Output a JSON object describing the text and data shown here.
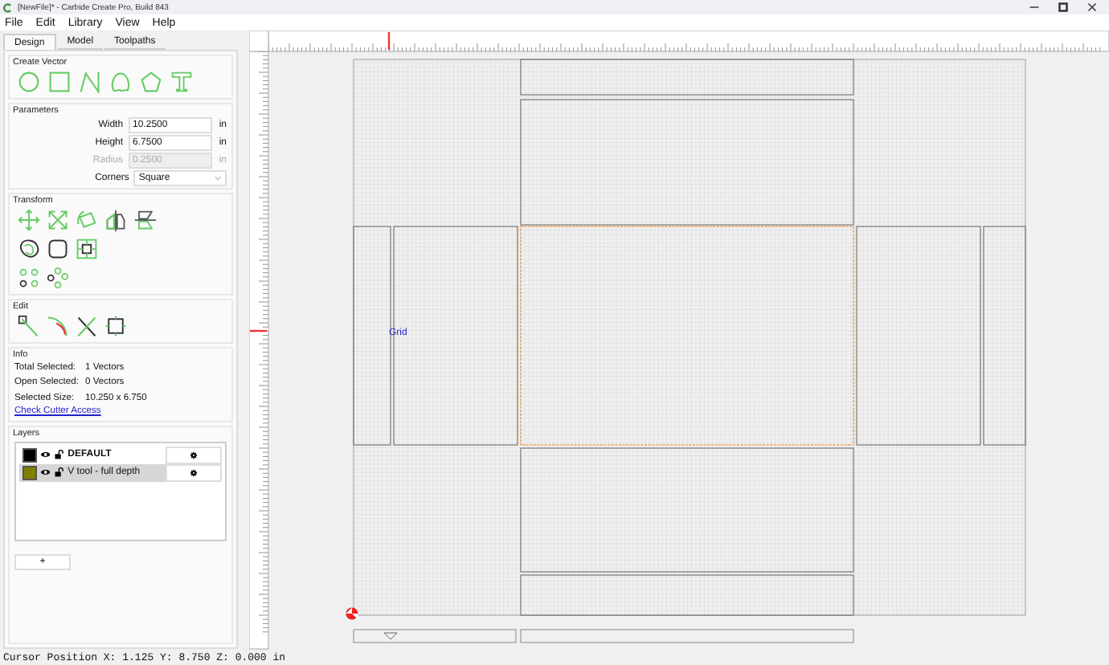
{
  "window": {
    "title": "[NewFile]* - Carbide Create Pro, Build 843"
  },
  "menu": [
    {
      "label": "File"
    },
    {
      "label": "Edit"
    },
    {
      "label": "Library"
    },
    {
      "label": "View"
    },
    {
      "label": "Help"
    }
  ],
  "tabs": [
    {
      "label": "Design",
      "selected": true
    },
    {
      "label": "Model",
      "selected": false
    },
    {
      "label": "Toolpaths",
      "selected": false
    }
  ],
  "create_vector": {
    "title": "Create Vector"
  },
  "parameters": {
    "title": "Parameters",
    "fields": [
      {
        "kind": "text",
        "label": "Width",
        "value": "10.2500",
        "unit": "in",
        "disabled": false
      },
      {
        "kind": "text",
        "label": "Height",
        "value": "6.7500",
        "unit": "in",
        "disabled": false
      },
      {
        "kind": "text",
        "label": "Radius",
        "value": "0.2500",
        "unit": "in",
        "disabled": true
      },
      {
        "kind": "dropdown",
        "label": "Corners",
        "value": "Square",
        "disabled": false
      }
    ]
  },
  "transform": {
    "title": "Transform"
  },
  "edit": {
    "title": "Edit"
  },
  "info": {
    "title": "Info",
    "rows": [
      {
        "label": "Total Selected:",
        "value": "1 Vectors"
      },
      {
        "label": "Open Selected:",
        "value": "0 Vectors"
      },
      {
        "label": "Selected Size:",
        "value": "10.250 x 6.750"
      }
    ],
    "link": "Check Cutter Access"
  },
  "layers": {
    "title": "Layers",
    "items": [
      {
        "name": "DEFAULT",
        "color": "#000000",
        "active": true,
        "selected": false
      },
      {
        "name": "V tool - full depth",
        "color": "#7f7f00",
        "active": false,
        "selected": true
      }
    ],
    "add_button": "+"
  },
  "canvas": {
    "grid_label": "Grid"
  },
  "status_bar": "Cursor Position X: 1.125 Y: 8.750 Z: 0.000 in"
}
